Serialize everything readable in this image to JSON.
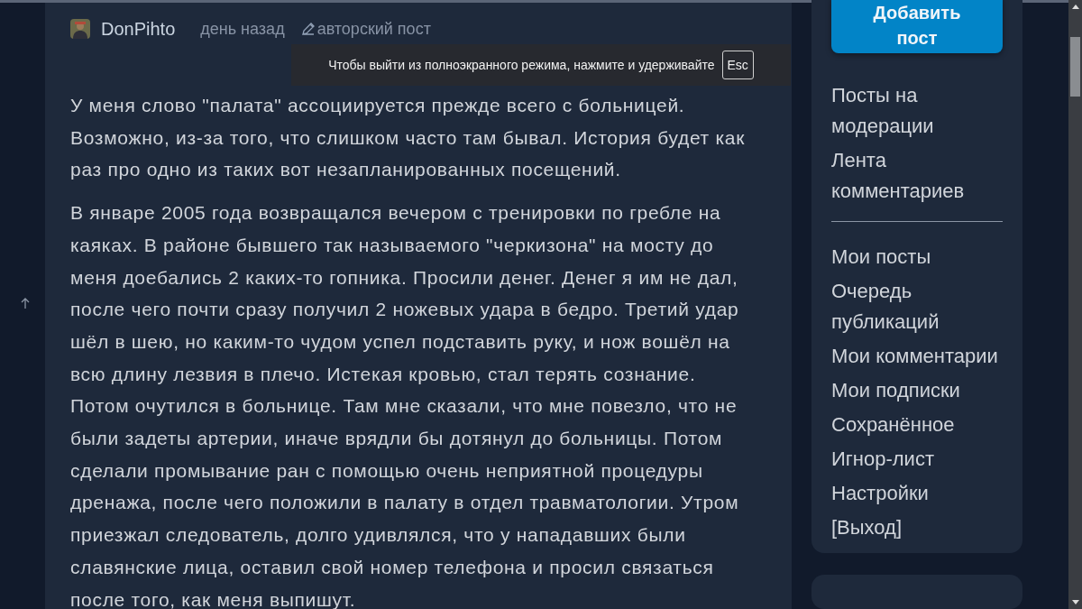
{
  "post": {
    "author": "DonPihto",
    "time": "день назад",
    "tag": "авторский пост",
    "paragraphs": [
      "У меня слово \"палата\" ассоциируется прежде всего с больницей. Возможно, из-за того, что слишком часто там бывал. История будет как раз про одно из таких вот незапланированных посещений.",
      "В январе 2005 года возвращался вечером с тренировки по гребле на каяках. В районе  бывшего так называемого \"черкизона\" на мосту до меня доебались 2 каких-то гопника. Просили денег. Денег я им не дал, после чего почти сразу получил 2 ножевых удара в бедро. Третий удар шёл в шею, но каким-то чудом успел подставить руку, и нож вошёл на всю длину лезвия  в плечо. Истекая кровью, стал терять сознание. Потом  очутился в больнице. Там мне сказали, что мне повезло, что не были задеты артерии, иначе врядли бы дотянул до больницы. Потом сделали промывание ран с помощью очень неприятной процедуры дренажа, после чего положили в палату в отдел травматологии. Утром приезжал  следователь, долго удивлялся, что у нападавших были славянские лица, оставил свой номер телефона и просил связаться после того, как меня выпишут."
    ]
  },
  "sidebar": {
    "add_button": "Добавить пост",
    "groups": [
      [
        "Посты на модерации",
        "Лента комментариев"
      ],
      [
        "Мои посты",
        "Очередь публикаций",
        "Мои комментарии",
        "Мои подписки",
        "Сохранённое",
        "Игнор-лист",
        "Настройки",
        "[Выход]"
      ]
    ]
  },
  "fullscreen_notice": {
    "text": "Чтобы выйти из полноэкранного режима, нажмите и удерживайте",
    "key": "Esc"
  }
}
